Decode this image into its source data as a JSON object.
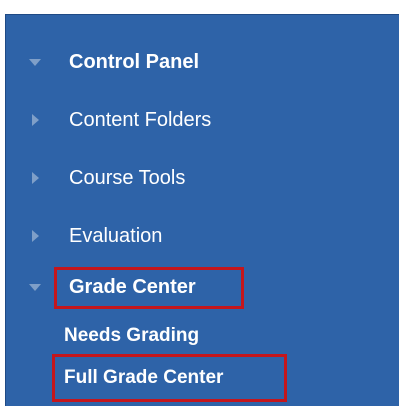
{
  "menu": {
    "control_panel": {
      "label": "Control Panel",
      "expanded": true,
      "icon": "caret-down-icon"
    },
    "items": [
      {
        "label": "Content Folders",
        "expanded": false,
        "icon": "caret-right-icon"
      },
      {
        "label": "Course Tools",
        "expanded": false,
        "icon": "caret-right-icon"
      },
      {
        "label": "Evaluation",
        "expanded": false,
        "icon": "caret-right-icon"
      }
    ],
    "grade_center": {
      "label": "Grade Center",
      "expanded": true,
      "icon": "caret-down-icon",
      "children": [
        {
          "label": "Needs Grading"
        },
        {
          "label": "Full Grade Center"
        }
      ]
    }
  },
  "colors": {
    "panel_background": "#2e63a8",
    "text": "#ffffff",
    "caret": "#7f9fc8",
    "highlight_border": "#c4161c"
  }
}
